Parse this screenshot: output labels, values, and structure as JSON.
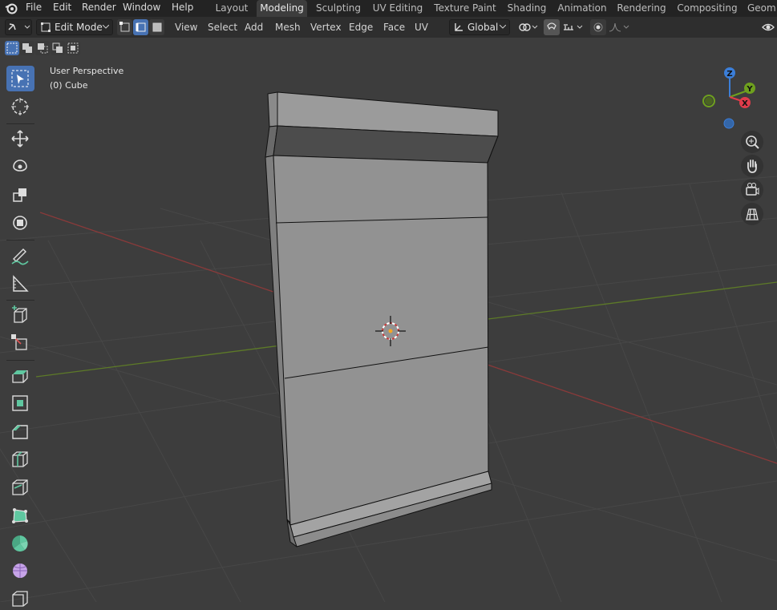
{
  "topbar": {
    "menu": [
      "File",
      "Edit",
      "Render",
      "Window",
      "Help"
    ],
    "workspaces": [
      "Layout",
      "Modeling",
      "Sculpting",
      "UV Editing",
      "Texture Paint",
      "Shading",
      "Animation",
      "Rendering",
      "Compositing",
      "Geom"
    ],
    "active_workspace": "Modeling"
  },
  "header": {
    "mode": "Edit Mode",
    "menus": [
      "View",
      "Select",
      "Add",
      "Mesh",
      "Vertex",
      "Edge",
      "Face",
      "UV"
    ],
    "transform_orientation": "Global",
    "select_mode_active": "edge"
  },
  "viewport": {
    "perspective_label": "User Perspective",
    "object_label": "(0) Cube"
  },
  "gizmo": {
    "z": "Z",
    "y": "Y",
    "x": "X",
    "colors": {
      "x": "#e03c4b",
      "y": "#6ea01e",
      "z": "#3b7ed8"
    }
  },
  "toolbar": {
    "active_tool": "select-box",
    "tools": [
      "select-box",
      "cursor",
      "move",
      "rotate",
      "scale",
      "transform",
      "annotate",
      "measure",
      "add-cube",
      "extrude-region",
      "inset-faces",
      "bevel",
      "loop-cut",
      "knife",
      "poly-build",
      "spin",
      "smooth",
      "shrink-fatten",
      "shear"
    ]
  },
  "colors": {
    "accent": "#4772b3",
    "grid_red_axis": "#8a3a3a",
    "grid_green_axis": "#5d7a28"
  }
}
